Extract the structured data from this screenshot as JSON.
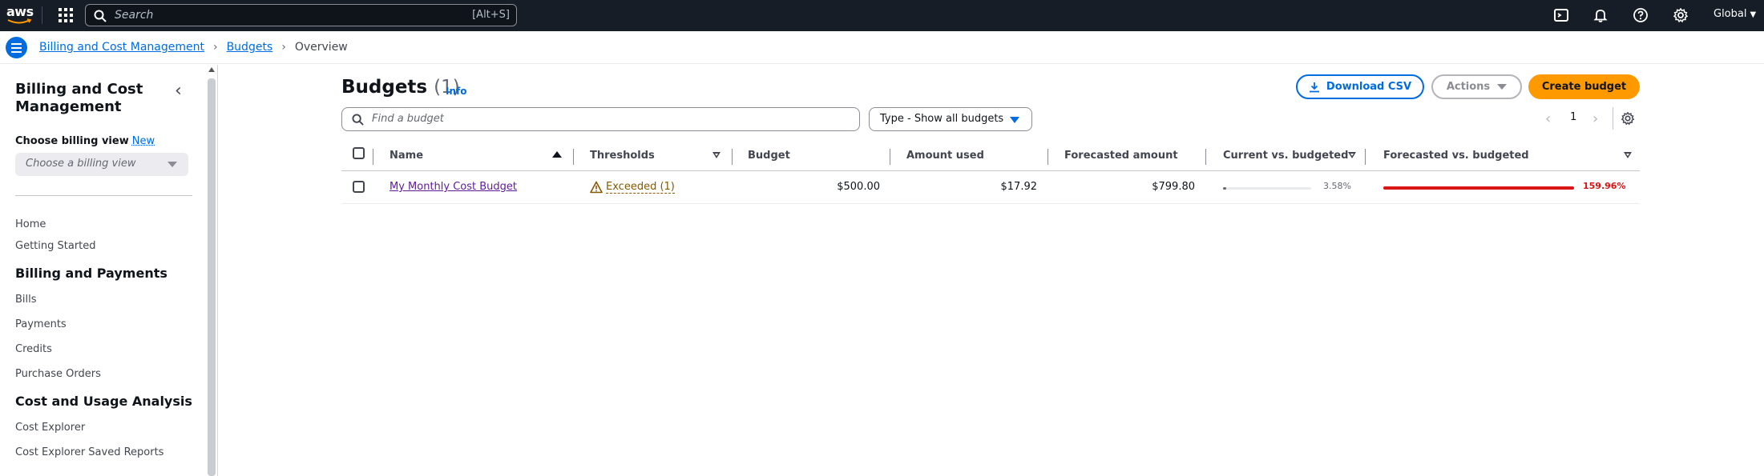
{
  "topnav": {
    "logo_text": "aws",
    "search_placeholder": "Search",
    "search_shortcut": "[Alt+S]",
    "region": "Global"
  },
  "breadcrumb": {
    "items": [
      "Billing and Cost Management",
      "Budgets"
    ],
    "current": "Overview"
  },
  "sidebar": {
    "title": "Billing and Cost Management",
    "choose_label": "Choose billing view",
    "new_badge": "New",
    "select_placeholder": "Choose a billing view",
    "items": {
      "home": "Home",
      "getting_started": "Getting Started",
      "billing_payments_head": "Billing and Payments",
      "bills": "Bills",
      "payments": "Payments",
      "credits": "Credits",
      "purchase_orders": "Purchase Orders",
      "cost_usage_head": "Cost and Usage Analysis",
      "cost_explorer": "Cost Explorer",
      "cost_explorer_saved": "Cost Explorer Saved Reports"
    }
  },
  "main": {
    "title": "Budgets",
    "count": "(1)",
    "info": "Info",
    "download_csv": "Download CSV",
    "actions": "Actions",
    "create_budget": "Create budget",
    "find_placeholder": "Find a budget",
    "type_filter": "Type - Show all budgets",
    "page": "1"
  },
  "table": {
    "columns": [
      "Name",
      "Thresholds",
      "Budget",
      "Amount used",
      "Forecasted amount",
      "Current vs. budgeted",
      "Forecasted vs. budgeted"
    ],
    "rows": [
      {
        "name": "My Monthly Cost Budget",
        "thresholds": "Exceeded (1)",
        "budget": "$500.00",
        "amount_used": "$17.92",
        "forecasted_amount": "$799.80",
        "current_vs_budgeted": "3.58%",
        "current_vs_budgeted_value": 0.0358,
        "forecasted_vs_budgeted": "159.96%",
        "forecasted_vs_budgeted_value": 1.5996
      }
    ]
  },
  "colors": {
    "nav_bg": "#161d26",
    "link": "#006ce0",
    "primary_button": "#ff9900",
    "exceeded": "#d91515",
    "warning": "#855900"
  }
}
